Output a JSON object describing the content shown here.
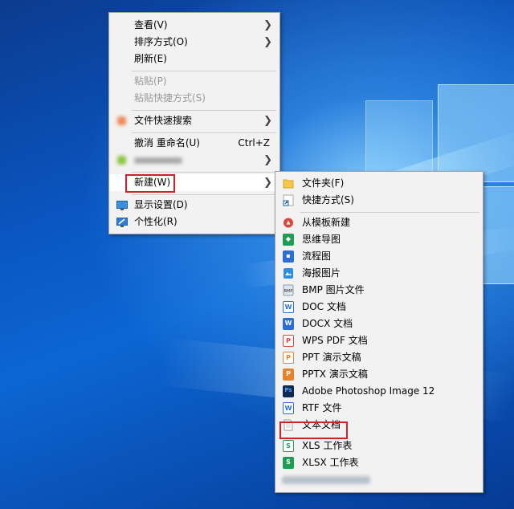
{
  "context_menu": {
    "items": [
      {
        "label": "查看(V)",
        "has_submenu": true
      },
      {
        "label": "排序方式(O)",
        "has_submenu": true
      },
      {
        "label": "刷新(E)"
      },
      {
        "label": "粘贴(P)",
        "disabled": true
      },
      {
        "label": "粘贴快捷方式(S)",
        "disabled": true
      },
      {
        "label": "文件快速搜索",
        "has_submenu": true
      },
      {
        "label": "撤消 重命名(U)",
        "shortcut": "Ctrl+Z"
      },
      {
        "label": "新建(W)",
        "has_submenu": true,
        "highlighted": true
      },
      {
        "label": "显示设置(D)",
        "icon": "display-icon"
      },
      {
        "label": "个性化(R)",
        "icon": "personalize-icon"
      }
    ]
  },
  "new_submenu": {
    "items": [
      {
        "label": "文件夹(F)",
        "icon": "folder-icon"
      },
      {
        "label": "快捷方式(S)",
        "icon": "shortcut-icon"
      },
      {
        "label": "从模板新建",
        "icon": "template-icon"
      },
      {
        "label": "思维导图",
        "icon": "mindmap-icon"
      },
      {
        "label": "流程图",
        "icon": "flowchart-icon"
      },
      {
        "label": "海报图片",
        "icon": "poster-icon"
      },
      {
        "label": "BMP 图片文件",
        "icon": "bmp-icon"
      },
      {
        "label": "DOC 文档",
        "icon": "doc-icon"
      },
      {
        "label": "DOCX 文档",
        "icon": "docx-icon"
      },
      {
        "label": "WPS PDF 文档",
        "icon": "pdf-icon"
      },
      {
        "label": "PPT 演示文稿",
        "icon": "ppt-icon"
      },
      {
        "label": "PPTX 演示文稿",
        "icon": "pptx-icon"
      },
      {
        "label": "Adobe Photoshop Image 12",
        "icon": "photoshop-icon"
      },
      {
        "label": "RTF 文件",
        "icon": "rtf-icon"
      },
      {
        "label": "文本文档",
        "icon": "text-document-icon",
        "highlighted": true
      },
      {
        "label": "XLS 工作表",
        "icon": "xls-icon"
      },
      {
        "label": "XLSX 工作表",
        "icon": "xlsx-icon"
      }
    ]
  },
  "colors": {
    "highlight_box": "#d0202a",
    "wps_blue": "#2b6fd6",
    "wps_green": "#1f9d55",
    "wps_orange": "#e8822a",
    "wps_red": "#e0453a"
  }
}
